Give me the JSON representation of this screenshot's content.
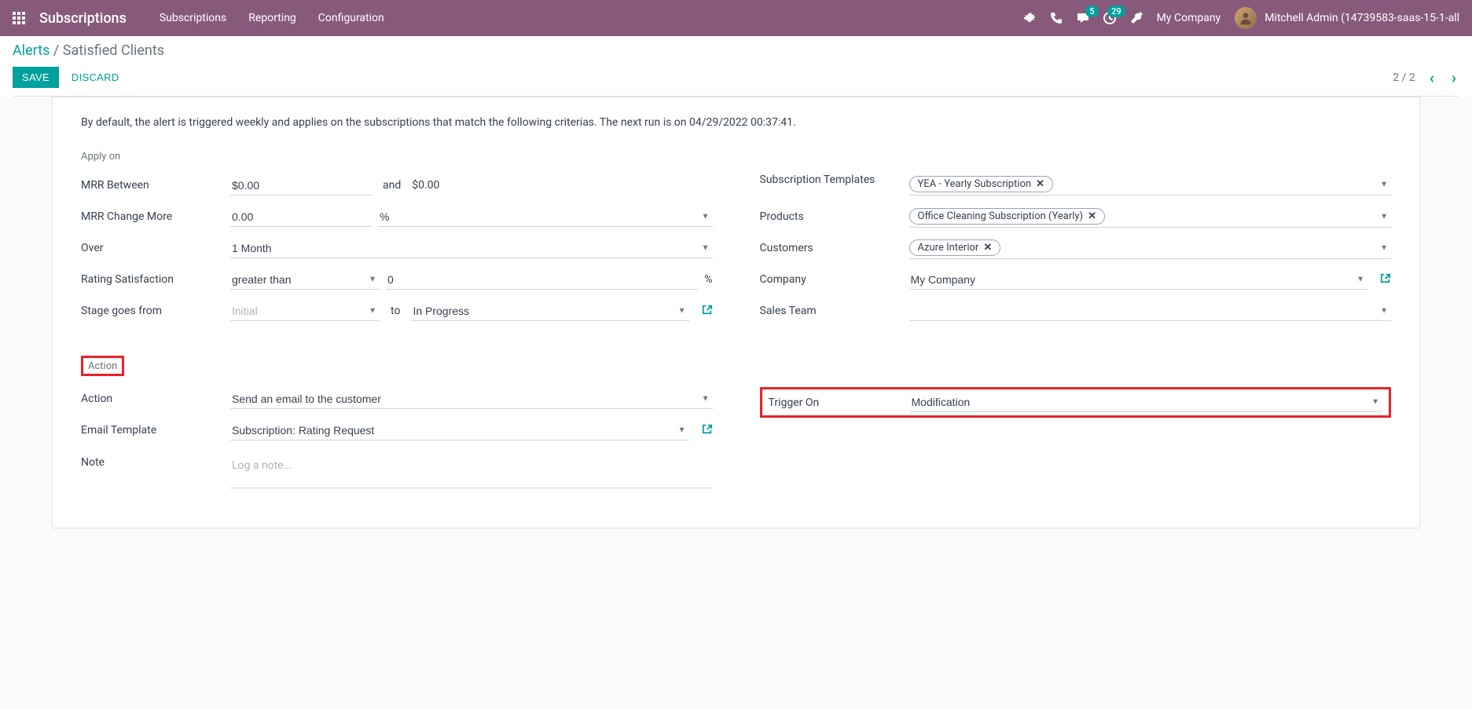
{
  "navbar": {
    "app_title": "Subscriptions",
    "menu": [
      "Subscriptions",
      "Reporting",
      "Configuration"
    ],
    "msg_badge": "5",
    "activity_badge": "29",
    "company": "My Company",
    "user": "Mitchell Admin (14739583-saas-15-1-all"
  },
  "breadcrumb": {
    "parent": "Alerts",
    "sep": " / ",
    "current": "Satisfied Clients"
  },
  "buttons": {
    "save": "SAVE",
    "discard": "DISCARD"
  },
  "pager": {
    "text": "2 / 2"
  },
  "form": {
    "info": "By default, the alert is triggered weekly and applies on the subscriptions that match the following criterias. The next run is on 04/29/2022 00:37:41.",
    "apply_on": "Apply on",
    "mrr_between_label": "MRR Between",
    "mrr_from": "$0.00",
    "and": "and",
    "mrr_to": "$0.00",
    "mrr_change_label": "MRR Change More",
    "mrr_change": "0.00",
    "percent": "%",
    "over_label": "Over",
    "over_value": "1 Month",
    "rating_label": "Rating Satisfaction",
    "rating_op": "greater than",
    "rating_val": "0",
    "stage_label": "Stage goes from",
    "stage_from_placeholder": "Initial",
    "to": "to",
    "stage_to": "In Progress",
    "sub_tmpl_label": "Subscription Templates",
    "sub_tmpl_tag": "YEA - Yearly Subscription",
    "products_label": "Products",
    "products_tag": "Office Cleaning Subscription (Yearly)",
    "customers_label": "Customers",
    "customers_tag": "Azure Interior",
    "company_label": "Company",
    "company_value": "My Company",
    "sales_team_label": "Sales Team",
    "action_header": "Action",
    "action_label": "Action",
    "action_value": "Send an email to the customer",
    "trigger_label": "Trigger On",
    "trigger_value": "Modification",
    "email_tmpl_label": "Email Template",
    "email_tmpl_value": "Subscription: Rating Request",
    "note_label": "Note",
    "note_placeholder": "Log a note..."
  }
}
